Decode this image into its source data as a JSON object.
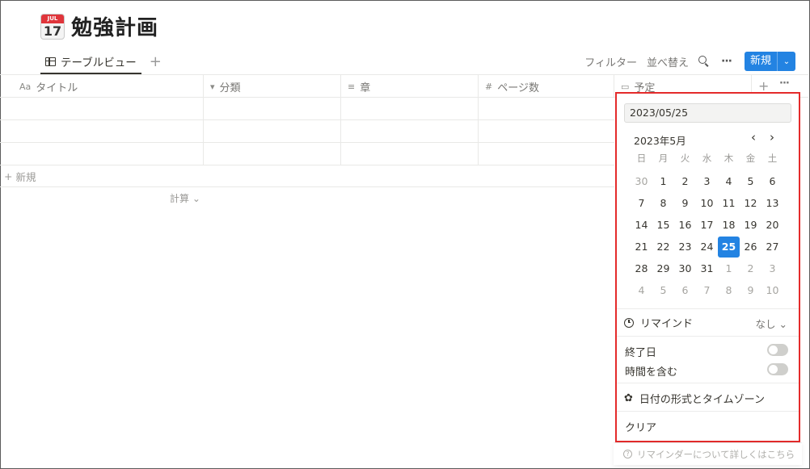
{
  "page": {
    "emoji_month": "JUL",
    "emoji_day": "17",
    "title": "勉強計画"
  },
  "view": {
    "tab_label": "テーブルビュー",
    "add": "+"
  },
  "toolbar": {
    "filter": "フィルター",
    "sort": "並べ替え",
    "more": "···",
    "new_label": "新規",
    "new_chevron": "⌄"
  },
  "table": {
    "columns": [
      {
        "icon": "Aa",
        "label": "タイトル"
      },
      {
        "icon": "▾",
        "label": "分類"
      },
      {
        "icon": "≡",
        "label": "章"
      },
      {
        "icon": "#",
        "label": "ページ数"
      },
      {
        "icon": "▭",
        "label": "予定"
      }
    ],
    "add_column": "+",
    "more": "···",
    "new_row": "新規",
    "calc": "計算 ⌄"
  },
  "date_picker": {
    "input_value": "2023/05/25",
    "month": "2023年5月",
    "prev": "‹",
    "next": "›",
    "weekdays": [
      "日",
      "月",
      "火",
      "水",
      "木",
      "金",
      "土"
    ],
    "weeks": [
      [
        "30",
        "1",
        "2",
        "3",
        "4",
        "5",
        "6"
      ],
      [
        "7",
        "8",
        "9",
        "10",
        "11",
        "12",
        "13"
      ],
      [
        "14",
        "15",
        "16",
        "17",
        "18",
        "19",
        "20"
      ],
      [
        "21",
        "22",
        "23",
        "24",
        "25",
        "26",
        "27"
      ],
      [
        "28",
        "29",
        "30",
        "31",
        "1",
        "2",
        "3"
      ],
      [
        "4",
        "5",
        "6",
        "7",
        "8",
        "9",
        "10"
      ]
    ],
    "selected_day": "25",
    "reminder_label": "リマインド",
    "reminder_value": "なし ⌄",
    "end_date_label": "終了日",
    "include_time_label": "時間を含む",
    "date_format_label": "日付の形式とタイムゾーン",
    "clear_label": "クリア",
    "help_text": "リマインダーについて詳しくはこちら",
    "accent": "#2383e2",
    "highlight_border": "#e42b2b"
  }
}
